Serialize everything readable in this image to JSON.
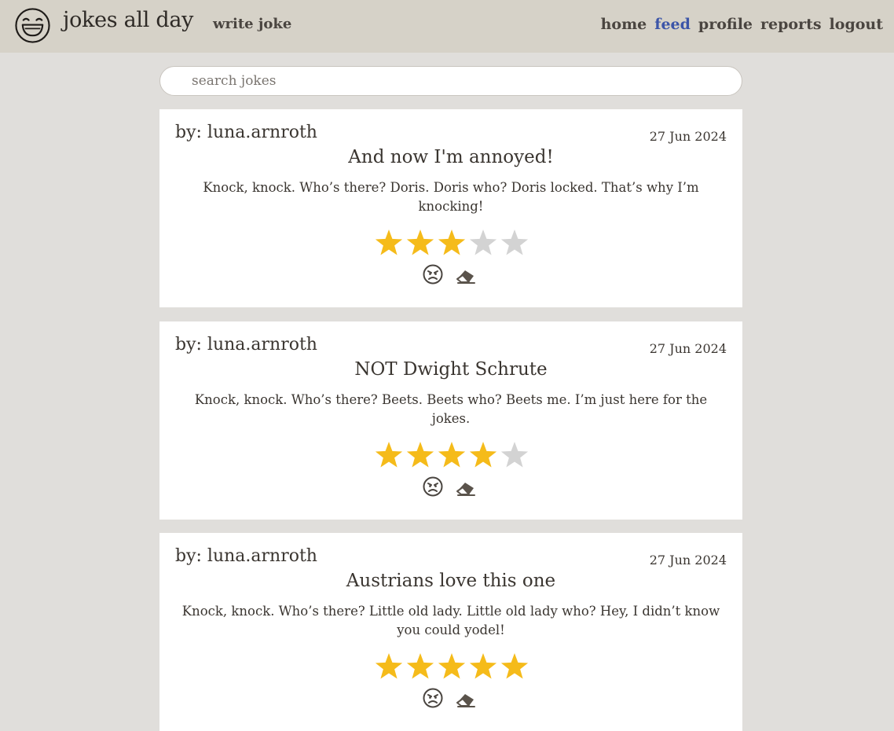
{
  "app": {
    "title": "jokes all day",
    "logo_icon": "laughing-face-icon"
  },
  "nav": {
    "write_label": "write joke",
    "links": [
      "home",
      "feed",
      "profile",
      "reports",
      "logout"
    ],
    "active": "feed",
    "active_color": "#3c55a8"
  },
  "search": {
    "placeholder": "search jokes",
    "value": ""
  },
  "colors": {
    "star_filled": "#f5bb1a",
    "star_empty": "#d3d3d3"
  },
  "jokes": [
    {
      "author": "by: luna.arnroth",
      "date": "27 Jun 2024",
      "title": "And now I'm annoyed!",
      "body": "Knock, knock. Who’s there? Doris. Doris who? Doris locked. That’s why I’m knocking!",
      "rating": 3,
      "max_rating": 5,
      "actions": [
        "angry-face-icon",
        "eraser-icon"
      ]
    },
    {
      "author": "by: luna.arnroth",
      "date": "27 Jun 2024",
      "title": "NOT Dwight Schrute",
      "body": "Knock, knock. Who’s there? Beets. Beets who? Beets me. I’m just here for the jokes.",
      "rating": 4,
      "max_rating": 5,
      "actions": [
        "angry-face-icon",
        "eraser-icon"
      ]
    },
    {
      "author": "by: luna.arnroth",
      "date": "27 Jun 2024",
      "title": "Austrians love this one",
      "body": "Knock, knock. Who’s there? Little old lady. Little old lady who? Hey, I didn’t know you could yodel!",
      "rating": 5,
      "max_rating": 5,
      "actions": [
        "angry-face-icon",
        "eraser-icon"
      ]
    }
  ]
}
